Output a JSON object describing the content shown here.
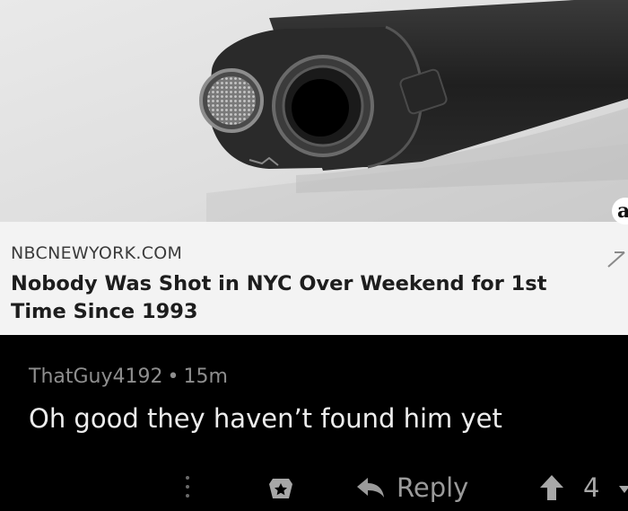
{
  "link_card": {
    "domain": "NBCNEWYORK.COM",
    "headline": "Nobody Was Shot in NYC Over Weekend for 1st Time Since 1993"
  },
  "corner_badge": "a",
  "comment": {
    "username": "ThatGuy4192",
    "separator": "•",
    "age": "15m",
    "text": "Oh good they haven’t found him yet"
  },
  "actions": {
    "reply_label": "Reply",
    "score": "4"
  },
  "icons": {
    "external_link": "arrow-icon",
    "more": "more-vertical-icon",
    "award": "award-icon",
    "reply": "reply-arrow-icon",
    "upvote": "upvote-icon",
    "downvote": "downvote-icon"
  }
}
